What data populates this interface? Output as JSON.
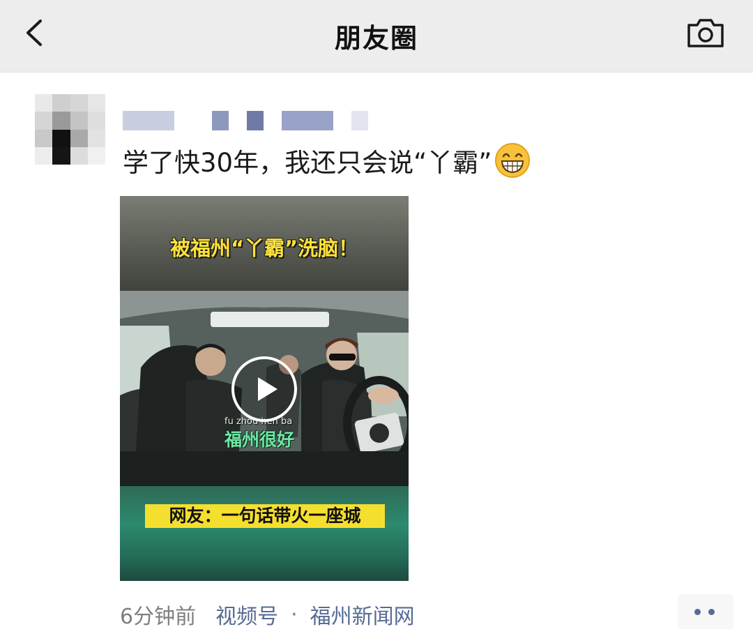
{
  "navbar": {
    "title": "朋友圈",
    "back_icon": "chevron-left-icon",
    "camera_icon": "camera-icon"
  },
  "post": {
    "text": "学了快30年，我还只会说“丫霸”",
    "emoji": "grinning-face-icon",
    "video": {
      "title_overlay": "被福州“丫霸”洗脑！",
      "subtitle_pinyin": "fu  zhou  hen  ba",
      "subtitle_text": "福州很好",
      "caption_overlay": "网友：一句话带火一座城",
      "play_icon": "play-icon"
    },
    "meta": {
      "time": "6分钟前",
      "channel": "视频号",
      "separator": "·",
      "source": "福州新闻网"
    },
    "more_icon": "more-dots-icon"
  },
  "colors": {
    "navbar_bg": "#ededed",
    "link": "#576b95",
    "meta_gray": "#7f7f7f",
    "overlay_yellow": "#ffe23a",
    "caption_yellow": "#f5df2e"
  }
}
